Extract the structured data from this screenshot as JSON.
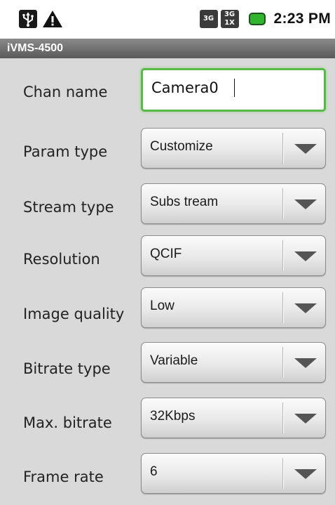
{
  "status_bar": {
    "network_labels": [
      "3G",
      "3G",
      "1X"
    ],
    "time": "2:23 PM",
    "colors": {
      "battery": "#31b52e",
      "usb": "#1a1a1a"
    },
    "icons": [
      "usb-icon",
      "warning-icon",
      "signal-3g-icon",
      "signal-1x-icon",
      "battery-icon"
    ]
  },
  "app": {
    "title": "iVMS-4500"
  },
  "form": {
    "fields": [
      {
        "label": "Chan name",
        "value": "Camera0",
        "kind": "text"
      },
      {
        "label": "Param type",
        "value": "Customize",
        "kind": "select"
      },
      {
        "label": "Stream type",
        "value": "Subs tream",
        "kind": "select"
      },
      {
        "label": "Resolution",
        "value": "QCIF",
        "kind": "select"
      },
      {
        "label": "Image quality",
        "value": "Low",
        "kind": "select"
      },
      {
        "label": "Bitrate type",
        "value": "Variable",
        "kind": "select"
      },
      {
        "label": "Max. bitrate",
        "value": "32Kbps",
        "kind": "select"
      },
      {
        "label": "Frame rate",
        "value": "6",
        "kind": "select"
      }
    ]
  }
}
